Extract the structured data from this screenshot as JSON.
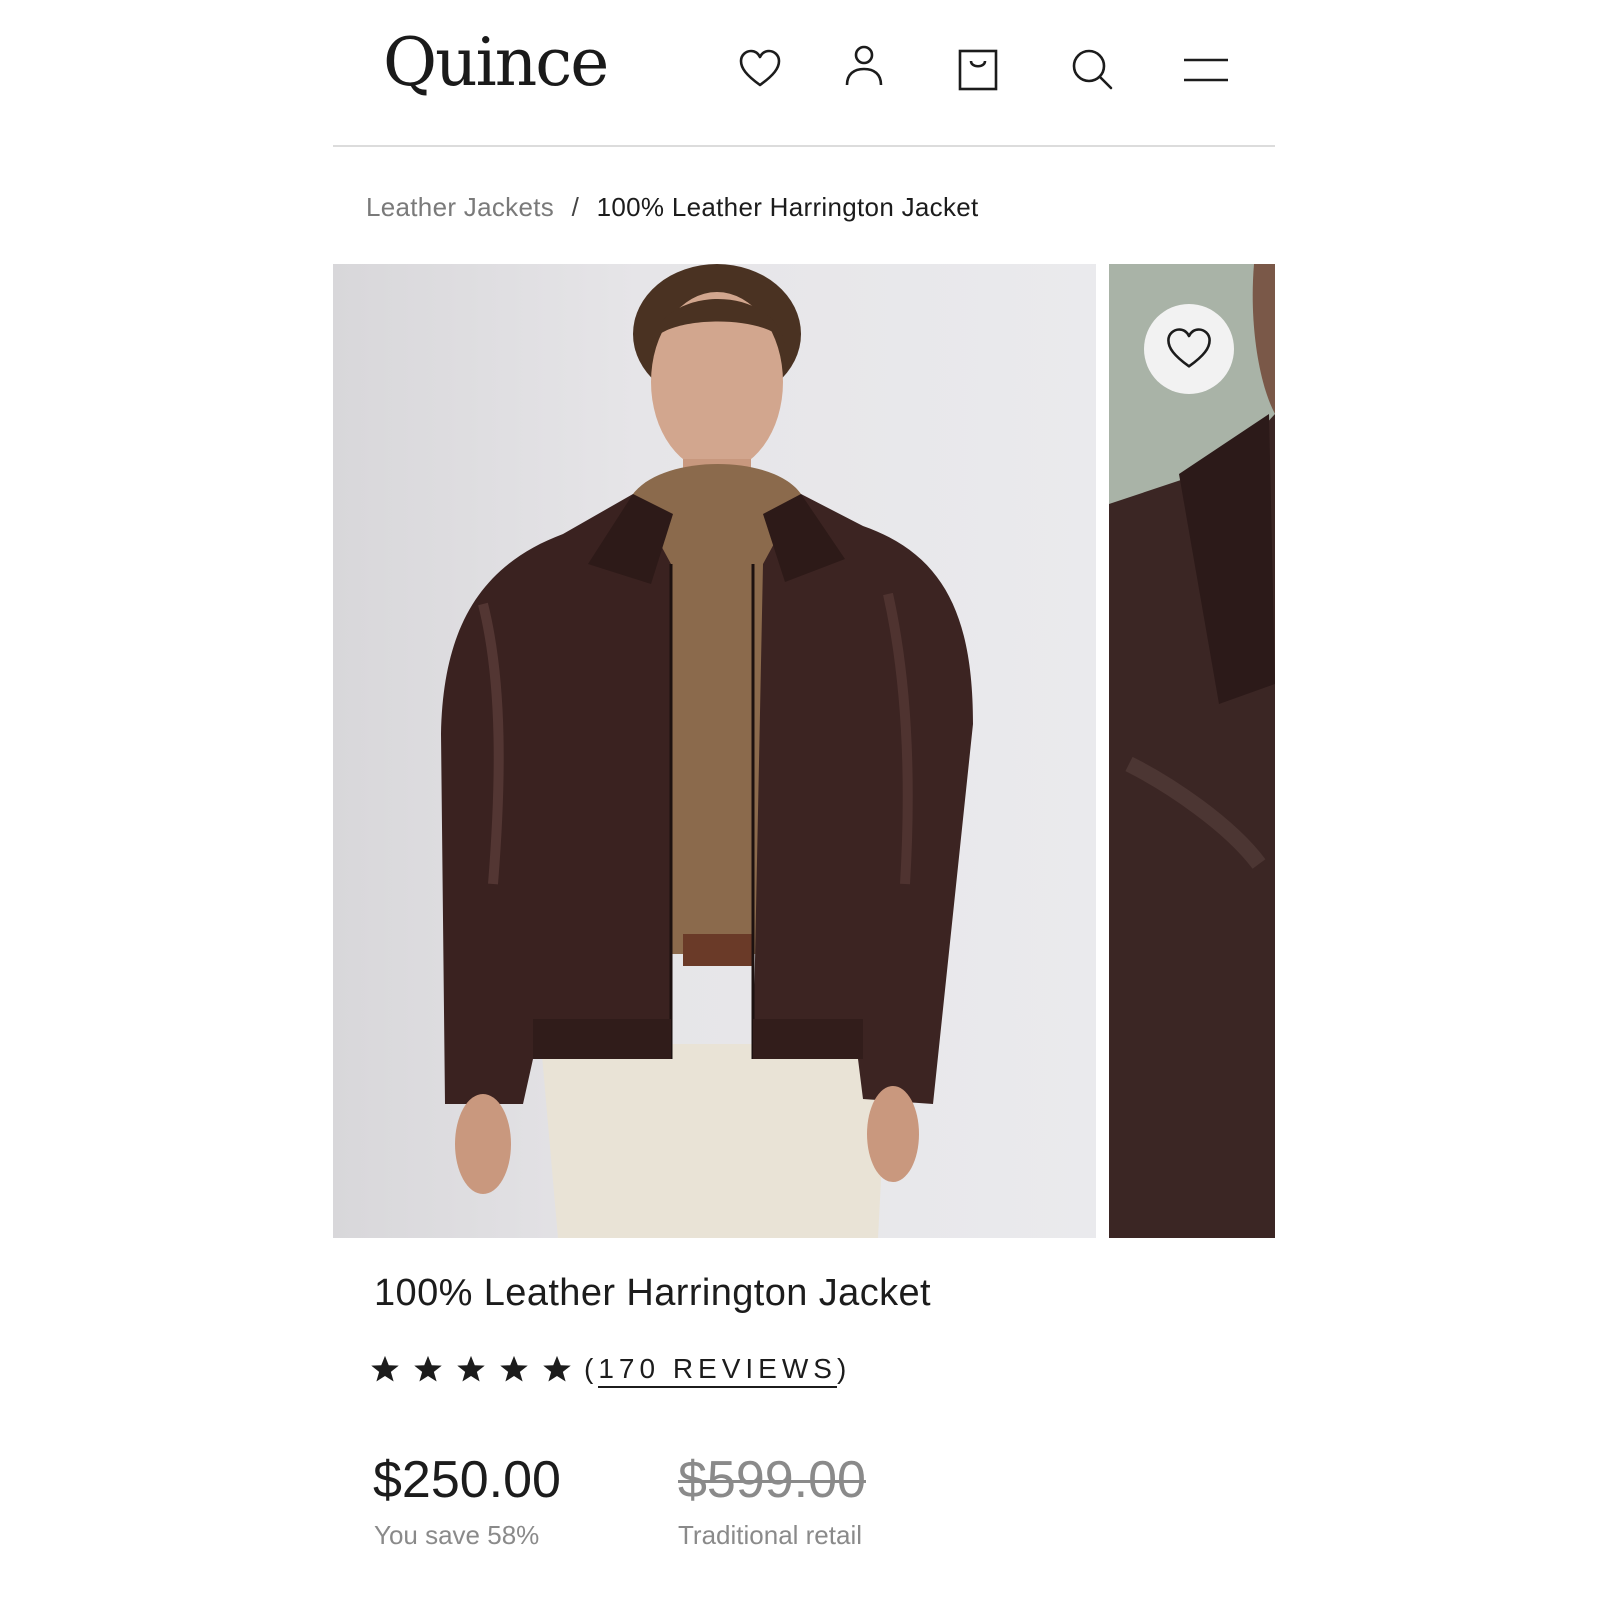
{
  "header": {
    "logo": "Quince",
    "icons": [
      "heart-icon",
      "account-icon",
      "bag-icon",
      "search-icon",
      "menu-icon"
    ]
  },
  "breadcrumb": {
    "parent": "Leather Jackets",
    "separator": "/",
    "current": "100% Leather Harrington Jacket"
  },
  "gallery": {
    "images": [
      "model-front-view",
      "collar-detail-view"
    ],
    "wishlist_icon": "heart-icon"
  },
  "product": {
    "title": "100% Leather Harrington Jacket",
    "rating_stars": 5,
    "reviews_prefix": "(",
    "reviews_text": "170 REVIEWS",
    "reviews_suffix": ")",
    "price": "$250.00",
    "savings": "You save 58%",
    "retail_price": "$599.00",
    "retail_label": "Traditional retail"
  },
  "colors": {
    "text": "#1c1c1c",
    "muted": "#8a8a8a",
    "divider": "#dcdcdc",
    "jacket": "#3a2220"
  }
}
